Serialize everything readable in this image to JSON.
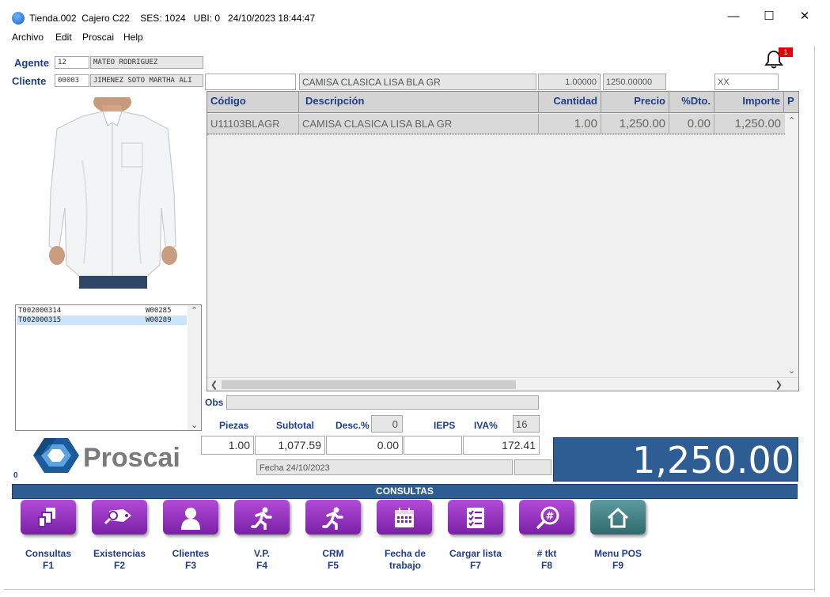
{
  "window": {
    "title": "Tienda.002  Cajero C22    SES: 1024   UBI: 0   24/10/2023 18:44:47"
  },
  "menu": [
    "Archivo",
    "Edit",
    "Proscai",
    "Help"
  ],
  "agent": {
    "label": "Agente",
    "code": "12",
    "name": "MATEO RODRIGUEZ"
  },
  "client": {
    "label": "Cliente",
    "code": "00003",
    "name": "JIMENEZ SOTO MARTHA ALI"
  },
  "notification": {
    "count": "1"
  },
  "entry": {
    "code": "",
    "description": "CAMISA CLASICA LISA BLA GR",
    "quantity": "1.00000",
    "price": "1250.00000",
    "extra": "XX"
  },
  "grid": {
    "columns": [
      "Código",
      "Descripción",
      "Cantidad",
      "Precio",
      "%Dto.",
      "Importe",
      "P"
    ],
    "rows": [
      {
        "code": "U11103BLAGR",
        "description": "CAMISA CLASICA LISA BLA GR",
        "quantity": "1.00",
        "price": "1,250.00",
        "discount": "0.00",
        "amount": "1,250.00"
      }
    ]
  },
  "tickets": [
    {
      "id": "T002000314",
      "ref": "W00285"
    },
    {
      "id": "T002000315",
      "ref": "W00289"
    }
  ],
  "obs": {
    "label": "Obs",
    "value": ""
  },
  "totals": {
    "pieces_label": "Piezas",
    "pieces": "1.00",
    "subtotal_label": "Subtotal",
    "subtotal": "1,077.59",
    "desc_label": "Desc.%",
    "desc_pct": "0",
    "desc_value": "0.00",
    "ieps_label": "IEPS",
    "ieps_value": "",
    "iva_label": "IVA%",
    "iva_pct": "16",
    "iva_value": "172.41",
    "date": "Fecha 24/10/2023",
    "grand_total": "1,250.00"
  },
  "brand": {
    "name": "Proscai"
  },
  "counter": "0",
  "section": "CONSULTAS",
  "buttons": [
    {
      "label": "Consultas",
      "key": "F1",
      "icon": "copy-icon"
    },
    {
      "label": "Existencias",
      "key": "F2",
      "icon": "tag-search-icon"
    },
    {
      "label": "Clientes",
      "key": "F3",
      "icon": "person-icon"
    },
    {
      "label": "V.P.",
      "key": "F4",
      "icon": "runner-icon"
    },
    {
      "label": "CRM",
      "key": "F5",
      "icon": "runner-icon"
    },
    {
      "label": "Fecha de trabajo",
      "key": "",
      "icon": "calendar-icon"
    },
    {
      "label": "Cargar lista",
      "key": "F7",
      "icon": "checklist-icon"
    },
    {
      "label": "# tkt",
      "key": "F8",
      "icon": "hash-search-icon"
    },
    {
      "label": "Menu POS",
      "key": "F9",
      "icon": "home-icon"
    }
  ],
  "colors": {
    "accent": "#2e5d93",
    "label": "#1f3d86",
    "button": "#9a35c6",
    "home_button": "#4a8589"
  }
}
